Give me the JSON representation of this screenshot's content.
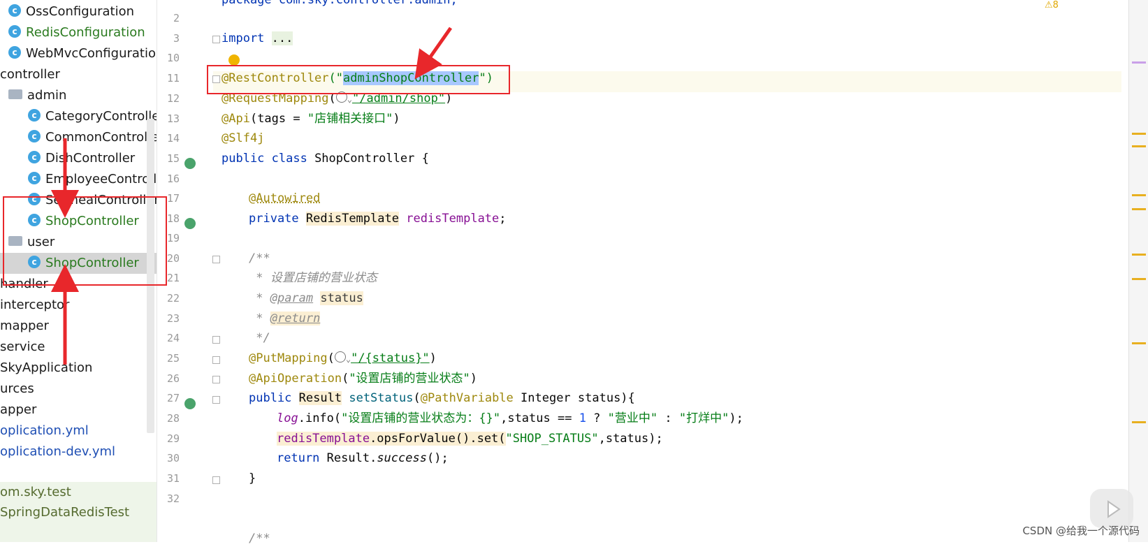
{
  "sidebar": {
    "items": [
      {
        "label": "OssConfiguration",
        "indent": 12,
        "icon": "class",
        "color": "default"
      },
      {
        "label": "RedisConfiguration",
        "indent": 12,
        "icon": "class",
        "color": "green"
      },
      {
        "label": "WebMvcConfiguratio",
        "indent": 12,
        "icon": "class",
        "color": "default"
      },
      {
        "label": "controller",
        "indent": 0,
        "icon": "none",
        "color": "default"
      },
      {
        "label": "admin",
        "indent": 12,
        "icon": "folder",
        "color": "default"
      },
      {
        "label": "CategoryControlle",
        "indent": 40,
        "icon": "class",
        "color": "default"
      },
      {
        "label": "CommonControlle",
        "indent": 40,
        "icon": "class",
        "color": "default"
      },
      {
        "label": "DishController",
        "indent": 40,
        "icon": "class",
        "color": "default"
      },
      {
        "label": "EmployeeControlle",
        "indent": 40,
        "icon": "class",
        "color": "default"
      },
      {
        "label": "SetmealController",
        "indent": 40,
        "icon": "class",
        "color": "default"
      },
      {
        "label": "ShopController",
        "indent": 40,
        "icon": "class",
        "color": "green"
      },
      {
        "label": "user",
        "indent": 12,
        "icon": "folder",
        "color": "default"
      },
      {
        "label": "ShopController",
        "indent": 40,
        "icon": "class",
        "color": "green",
        "selected": true
      },
      {
        "label": "handler",
        "indent": 0,
        "icon": "none",
        "color": "default"
      },
      {
        "label": "interceptor",
        "indent": 0,
        "icon": "none",
        "color": "default"
      },
      {
        "label": "mapper",
        "indent": 0,
        "icon": "none",
        "color": "default"
      },
      {
        "label": "service",
        "indent": 0,
        "icon": "none",
        "color": "default"
      },
      {
        "label": "SkyApplication",
        "indent": 0,
        "icon": "none",
        "color": "default"
      },
      {
        "label": "urces",
        "indent": 0,
        "icon": "none",
        "color": "default"
      },
      {
        "label": "apper",
        "indent": 0,
        "icon": "none",
        "color": "default"
      },
      {
        "label": "oplication.yml",
        "indent": 0,
        "icon": "none",
        "color": "blue"
      },
      {
        "label": "oplication-dev.yml",
        "indent": 0,
        "icon": "none",
        "color": "blue"
      }
    ],
    "bottom": [
      {
        "label": "om.sky.test"
      },
      {
        "label": "SpringDataRedisTest"
      }
    ]
  },
  "editor": {
    "line_numbers": [
      "2",
      "3",
      "10",
      "11",
      "12",
      "13",
      "14",
      "15",
      "16",
      "17",
      "18",
      "19",
      "20",
      "21",
      "22",
      "23",
      "24",
      "25",
      "26",
      "27",
      "28",
      "29",
      "30",
      "31",
      "32"
    ],
    "top_partial": "package com.sky.controller.admin;",
    "import_kw": "import",
    "import_dots": "...",
    "l11_ann": "@RestController",
    "l11_open": "(\"",
    "l11_sel": "adminShopController",
    "l11_close": "\")",
    "l12_ann": "@RequestMapping",
    "l12_open": "(",
    "l12_str": "\"/admin/shop\"",
    "l12_close": ")",
    "l13_ann": "@Api",
    "l13_mid": "(tags = ",
    "l13_str": "\"店铺相关接口\"",
    "l13_close": ")",
    "l14_ann": "@Slf4j",
    "l15_kw": "public class",
    "l15_rest": " ShopController {",
    "l17_ann": "@Autowired",
    "l18_kw": "private",
    "l18_type": "RedisTemplate",
    "l18_field": "redisTemplate",
    "l18_semi": ";",
    "l20": "/**",
    "l21": " * 设置店铺的营业状态",
    "l22_star": " * ",
    "l22_tag": "@param",
    "l22_name": "status",
    "l23_star": " * ",
    "l23_tag": "@return",
    "l24": " */",
    "l25_ann": "@PutMapping",
    "l25_open": "(",
    "l25_str": "\"/{status}\"",
    "l25_close": ")",
    "l26_ann": "@ApiOperation",
    "l26_open": "(",
    "l26_str": "\"设置店铺的营业状态\"",
    "l26_close": ")",
    "l27_kw": "public",
    "l27_type": "Result",
    "l27_method": "setStatus",
    "l27_open": "(",
    "l27_ann": "@PathVariable",
    "l27_rest": " Integer status){",
    "l28_log": "log",
    "l28_info": ".info(",
    "l28_str": "\"设置店铺的营业状态为：{}\"",
    "l28_mid": ",status == ",
    "l28_num": "1",
    "l28_q": " ? ",
    "l28_s1": "\"营业中\"",
    "l28_colon": " : ",
    "l28_s2": "\"打烊中\"",
    "l28_end": ");",
    "l29_field": "redisTemplate",
    "l29_mid": ".opsForValue().set(",
    "l29_str": "\"SHOP_STATUS\"",
    "l29_end": ",status);",
    "l30_kw": "return",
    "l30_cls": " Result.",
    "l30_m": "success",
    "l30_end": "();",
    "l31": "}",
    "l33": "/**"
  },
  "top_bar": {
    "warnings": "8"
  },
  "watermark": "CSDN @给我一个源代码",
  "colors": {
    "accent_red": "#e8272b",
    "keyword": "#0033b3",
    "annotation": "#9e880d",
    "string": "#067d17",
    "selection": "#a8c8ff"
  }
}
